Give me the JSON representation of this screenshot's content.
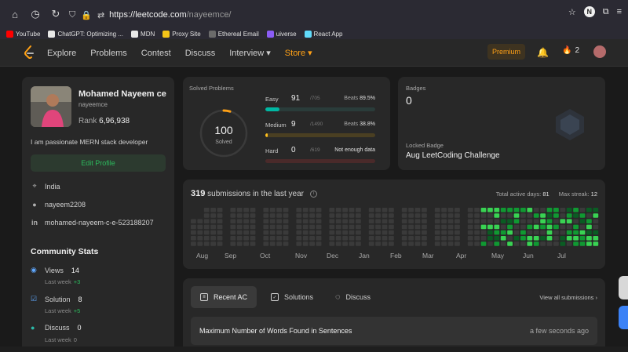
{
  "browser": {
    "url_host": "https://leetcode.com",
    "url_path": "/nayeemce/",
    "bookmarks": [
      {
        "label": "YouTube",
        "color": "#ff0000"
      },
      {
        "label": "ChatGPT: Optimizing ...",
        "color": "#e8e8e8"
      },
      {
        "label": "MDN",
        "color": "#e8e8e8"
      },
      {
        "label": "Proxy Site",
        "color": "#f5c518"
      },
      {
        "label": "Ethereal Email",
        "color": "#6b6b6b"
      },
      {
        "label": "uiverse",
        "color": "#8b5cf6"
      },
      {
        "label": "React App",
        "color": "#61dafb"
      }
    ],
    "profile_initial": "N"
  },
  "nav": {
    "items": [
      "Explore",
      "Problems",
      "Contest",
      "Discuss",
      "Interview ▾",
      "Store ▾"
    ],
    "premium": "Premium",
    "streak_count": "2"
  },
  "profile": {
    "name": "Mohamed Nayeem ce",
    "username": "nayeemce",
    "rank_label": "Rank",
    "rank_value": "6,96,938",
    "bio": "I am passionate MERN stack developer",
    "edit_label": "Edit Profile",
    "location": "India",
    "github": "nayeem2208",
    "linkedin": "mohamed-nayeem-c-e-523188207",
    "community_title": "Community Stats",
    "stats": [
      {
        "label": "Views",
        "value": "14",
        "week_label": "Last week",
        "delta": "+3"
      },
      {
        "label": "Solution",
        "value": "8",
        "week_label": "Last week",
        "delta": "+5"
      },
      {
        "label": "Discuss",
        "value": "0",
        "week_label": "Last week",
        "delta": "0"
      }
    ]
  },
  "solved": {
    "title": "Solved Problems",
    "total": "100",
    "total_label": "Solved",
    "difficulties": [
      {
        "name": "Easy",
        "count": "91",
        "total": "/705",
        "beats_label": "Beats",
        "beats": "89.5%",
        "fraction": 0.129,
        "color": "#00b8a3",
        "track": "#2a3c3a"
      },
      {
        "name": "Medium",
        "count": "9",
        "total": "/1490",
        "beats_label": "Beats",
        "beats": "38.8%",
        "fraction": 0.006,
        "color": "#ffc01e",
        "track": "#4a3f22"
      },
      {
        "name": "Hard",
        "count": "0",
        "total": "/619",
        "beats_label": "",
        "beats": "Not enough data",
        "fraction": 0,
        "color": "#ef4743",
        "track": "#4a2a2a"
      }
    ]
  },
  "badges": {
    "title": "Badges",
    "count": "0",
    "locked_label": "Locked Badge",
    "locked_name": "Aug LeetCoding Challenge"
  },
  "submissions": {
    "count": "319",
    "label": "submissions in the last year",
    "active_days_label": "Total active days:",
    "active_days": "81",
    "max_streak_label": "Max streak:",
    "max_streak": "12",
    "months": [
      "Aug",
      "Sep",
      "Oct",
      "Nov",
      "Dec",
      "Jan",
      "Feb",
      "Mar",
      "Apr",
      "May",
      "Jun",
      "Jul"
    ]
  },
  "recent": {
    "tabs": [
      "Recent AC",
      "Solutions",
      "Discuss"
    ],
    "view_all": "View all submissions ›",
    "items": [
      {
        "title": "Maximum Number of Words Found in Sentences",
        "time": "a few seconds ago"
      }
    ]
  }
}
